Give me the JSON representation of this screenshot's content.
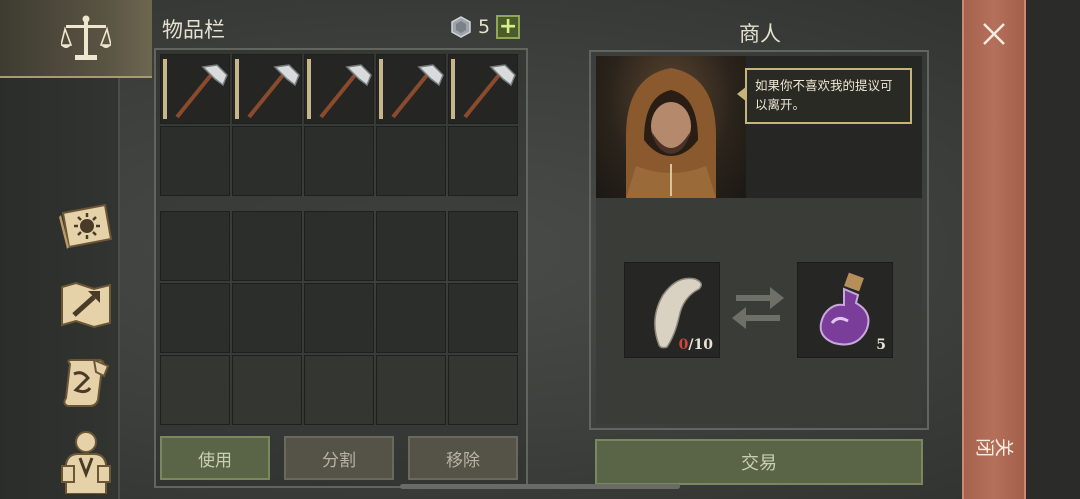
{
  "inventory": {
    "title": "物品栏",
    "currency_count": "5",
    "add_label": "+",
    "items": [
      "pickaxe",
      "pickaxe",
      "pickaxe",
      "pickaxe",
      "pickaxe"
    ],
    "buttons": {
      "use": "使用",
      "split": "分割",
      "remove": "移除"
    }
  },
  "merchant": {
    "title": "商人",
    "speech": "如果你不喜欢我的提议可以离开。",
    "give": {
      "icon": "tooth-icon",
      "have": "0",
      "need": "/10"
    },
    "receive": {
      "icon": "potion-icon",
      "count": "5"
    },
    "trade_label": "交易"
  },
  "close": {
    "icon": "close-icon",
    "label": "关闭"
  },
  "nav": [
    "balance-scale-icon",
    "sun-book-icon",
    "map-icon",
    "scroll-icon",
    "character-icon"
  ],
  "colors": {
    "accent_green": "#5a6446",
    "close_red": "#a6624e",
    "speech_border": "#c7b47b",
    "count_red": "#d2453a"
  }
}
